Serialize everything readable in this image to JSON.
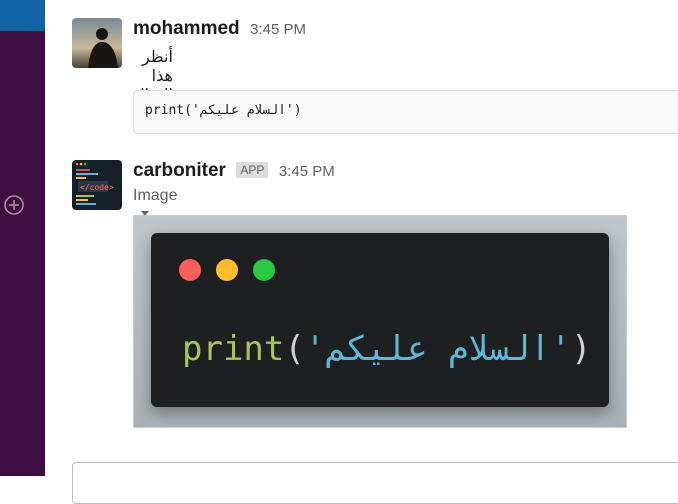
{
  "colors": {
    "sidebar": "#3f0e40",
    "sidebar_active": "#1164a3",
    "carbon_bg": "#1e1f21",
    "dot_red": "#fe5f58",
    "dot_yellow": "#febc2e",
    "dot_green": "#28c840",
    "code_function": "#a6c659",
    "code_string": "#5fb7d6"
  },
  "messages": [
    {
      "username": "mohammed",
      "time": "3:45 PM",
      "text": "أنظر هذا المثال",
      "code_snippet": "print('السلام عليكم')"
    },
    {
      "username": "carboniter",
      "badge": "APP",
      "time": "3:45 PM",
      "attachment_label": "Image",
      "image_code": {
        "fn": "print",
        "open": "(",
        "string": "'السلام عليكم'",
        "close": ")"
      }
    }
  ],
  "icons": {
    "add": "plus-circle-icon",
    "caret": "chevron-down-icon"
  }
}
